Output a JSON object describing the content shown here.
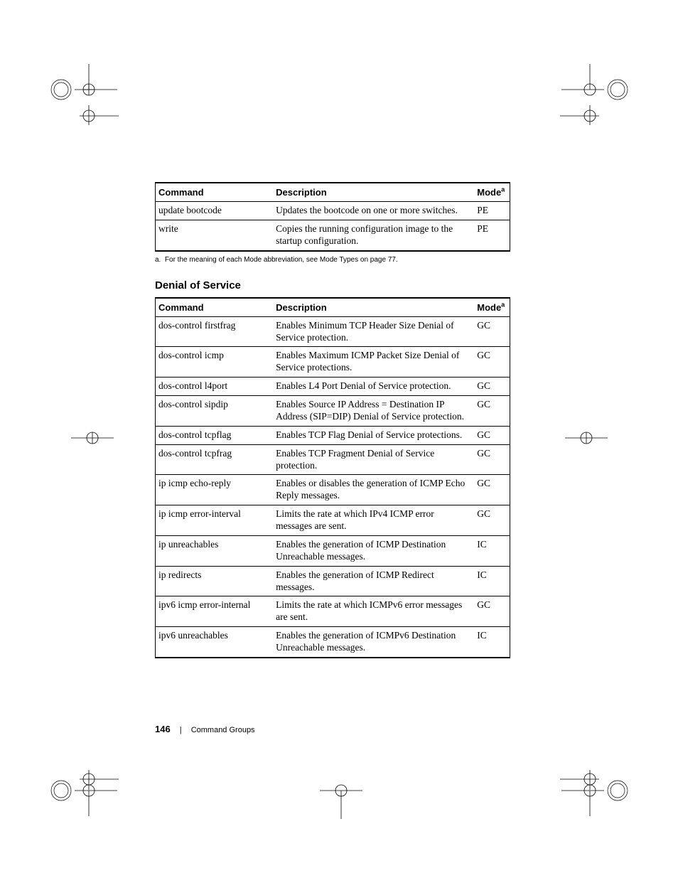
{
  "table1": {
    "headers": {
      "cmd": "Command",
      "desc": "Description",
      "mode": "Mode",
      "sup": "a"
    },
    "rows": [
      {
        "cmd": "update bootcode",
        "desc": "Updates the bootcode on one or more switches.",
        "mode": "PE"
      },
      {
        "cmd": "write",
        "desc": "Copies the running configuration image to the startup configuration.",
        "mode": "PE"
      }
    ],
    "footnote_label": "a.",
    "footnote_text": "For the meaning of each Mode abbreviation, see Mode Types on page 77."
  },
  "section_heading": "Denial of Service",
  "table2": {
    "headers": {
      "cmd": "Command",
      "desc": "Description",
      "mode": "Mode",
      "sup": "a"
    },
    "rows": [
      {
        "cmd": "dos-control firstfrag",
        "desc": "Enables Minimum TCP Header Size Denial of Service protection.",
        "mode": "GC"
      },
      {
        "cmd": "dos-control icmp",
        "desc": "Enables Maximum ICMP Packet Size Denial of Service protections.",
        "mode": "GC"
      },
      {
        "cmd": "dos-control l4port",
        "desc": "Enables L4 Port Denial of Service protection.",
        "mode": "GC"
      },
      {
        "cmd": "dos-control sipdip",
        "desc": "Enables Source IP Address = Destination IP Address (SIP=DIP) Denial of Service protection.",
        "mode": "GC"
      },
      {
        "cmd": "dos-control tcpflag",
        "desc": "Enables TCP Flag Denial of Service protections.",
        "mode": "GC"
      },
      {
        "cmd": "dos-control tcpfrag",
        "desc": "Enables TCP Fragment Denial of Service protection.",
        "mode": "GC"
      },
      {
        "cmd": "ip icmp echo-reply",
        "desc": "Enables or disables the generation of ICMP Echo Reply messages.",
        "mode": "GC"
      },
      {
        "cmd": "ip icmp error-interval",
        "desc": "Limits the rate at which IPv4 ICMP error messages are sent.",
        "mode": "GC"
      },
      {
        "cmd": "ip unreachables",
        "desc": "Enables the generation of ICMP Destination Unreachable messages.",
        "mode": "IC"
      },
      {
        "cmd": "ip redirects",
        "desc": "Enables the generation of ICMP Redirect messages.",
        "mode": "IC"
      },
      {
        "cmd": "ipv6 icmp error-internal",
        "desc": "Limits the rate at which ICMPv6 error messages are sent.",
        "mode": "GC"
      },
      {
        "cmd": "ipv6 unreachables",
        "desc": "Enables the generation of ICMPv6 Destination Unreachable messages.",
        "mode": "IC"
      }
    ]
  },
  "footer": {
    "page": "146",
    "section": "Command Groups"
  }
}
